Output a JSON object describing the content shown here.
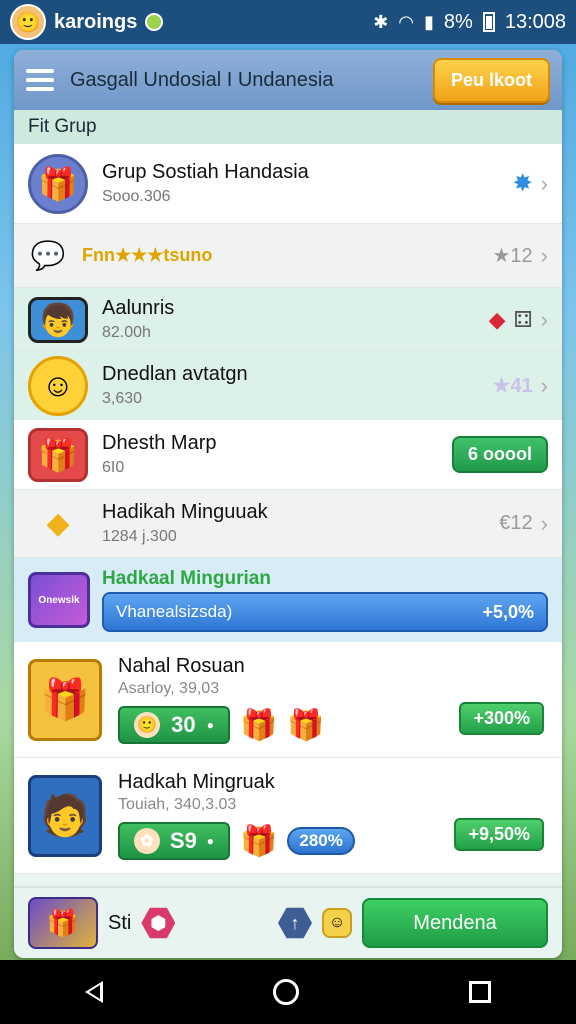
{
  "status_bar": {
    "app_name": "karoings",
    "battery": "8%",
    "time": "13:008"
  },
  "header": {
    "title": "Gasgall Undosial I Undanesia",
    "action_label": "Peu lkoot"
  },
  "section_title": "Fit Grup",
  "rows": [
    {
      "title": "Grup Sostiah Handasia",
      "sub": "Sooo.306"
    },
    {
      "title": "Fnn★★★tsuno",
      "right": "★12"
    },
    {
      "title": "Aalunris",
      "sub": "82.00h"
    },
    {
      "title": "Dnedlan avtatgn",
      "sub": "3,630",
      "right": "★41"
    },
    {
      "title": "Dhesth Marp",
      "sub": "6I0",
      "button": "6 ooool"
    },
    {
      "title": "Hadikah Minguuak",
      "sub": "1284 j.300",
      "right": "€12"
    }
  ],
  "featured": {
    "title": "Hadkaal Mingurian",
    "bar_label": "Vhanealsizsda)",
    "bar_value": "+5,0%",
    "thumb_label": "Onewslk"
  },
  "offers": [
    {
      "title": "Nahal Rosuan",
      "sub": "Asarloy, 39,03",
      "price": "30",
      "pct": "+300%"
    },
    {
      "title": "Hadkah Mingruak",
      "sub": "Touiah, 340,3.03",
      "price": "S9",
      "badge": "280%",
      "pct": "+9,50%"
    }
  ],
  "bottom": {
    "label": "Sti",
    "cta": "Mendena"
  }
}
